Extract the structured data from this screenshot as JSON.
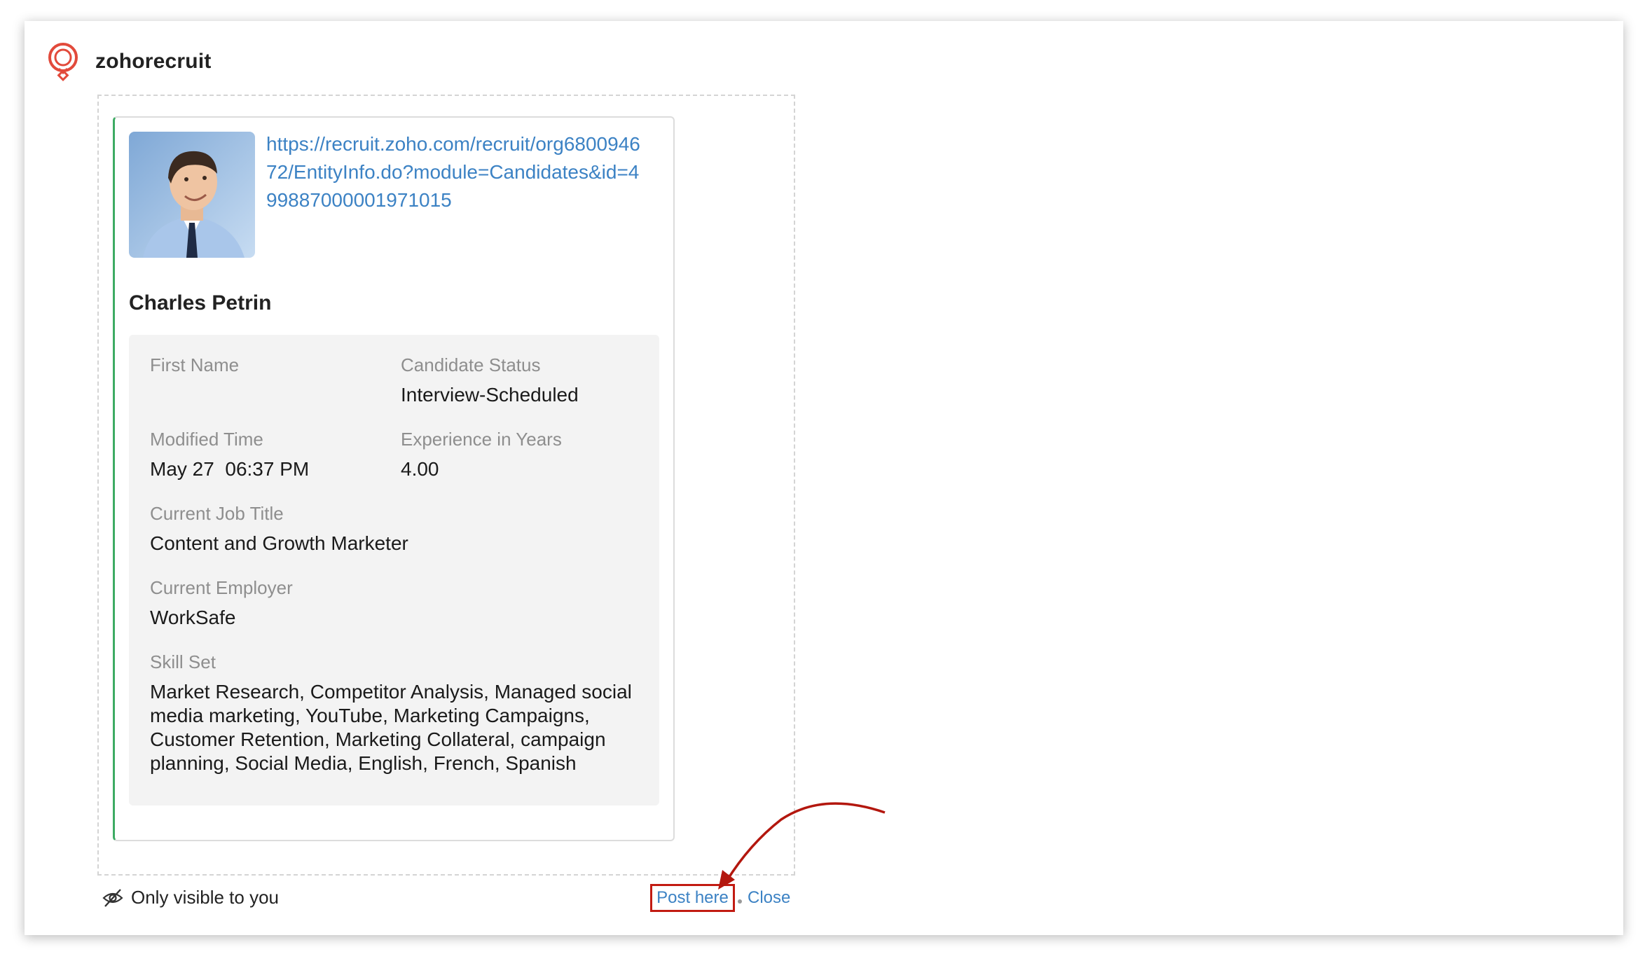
{
  "app": {
    "name": "zohorecruit",
    "logo_icon": "zohorecruit-logo-icon",
    "brand_color": "#e24a3b"
  },
  "card": {
    "photo_icon": "candidate-photo",
    "record_url": "https://recruit.zoho.com/recruit/org680094672/EntityInfo.do?module=Candidates&id=499887000001971015",
    "candidate_name": "Charles Petrin",
    "accent_color": "#3dab63",
    "fields": {
      "first_name": {
        "label": "First Name",
        "value": ""
      },
      "candidate_status": {
        "label": "Candidate Status",
        "value": "Interview-Scheduled"
      },
      "modified_time": {
        "label": "Modified Time",
        "value": "May 27  06:37 PM"
      },
      "experience": {
        "label": "Experience in Years",
        "value": "4.00"
      },
      "current_job_title": {
        "label": "Current Job Title",
        "value": "Content and Growth Marketer"
      },
      "current_employer": {
        "label": "Current Employer",
        "value": "WorkSafe"
      },
      "skill_set": {
        "label": "Skill Set",
        "value": "Market Research, Competitor Analysis, Managed social media marketing, YouTube, Marketing Campaigns, Customer Retention, Marketing Collateral, campaign planning, Social Media, English, French, Spanish"
      }
    }
  },
  "footer": {
    "visibility_icon": "eye-slash-icon",
    "visibility_text": "Only visible to you",
    "post_here_label": "Post here",
    "close_label": "Close",
    "link_color": "#3c82c4",
    "highlight_color": "#c21b12"
  }
}
